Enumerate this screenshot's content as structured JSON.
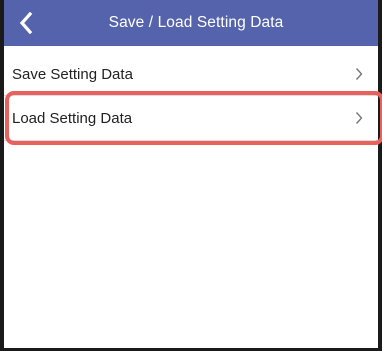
{
  "header": {
    "title": "Save / Load Setting Data",
    "back_icon": "chevron-left-icon",
    "background_color": "#5563ad"
  },
  "list": {
    "items": [
      {
        "label": "Save Setting Data",
        "icon": "chevron-right-icon"
      },
      {
        "label": "Load Setting Data",
        "icon": "chevron-right-icon",
        "highlighted": true
      }
    ]
  },
  "highlight_color": "#e8615d"
}
